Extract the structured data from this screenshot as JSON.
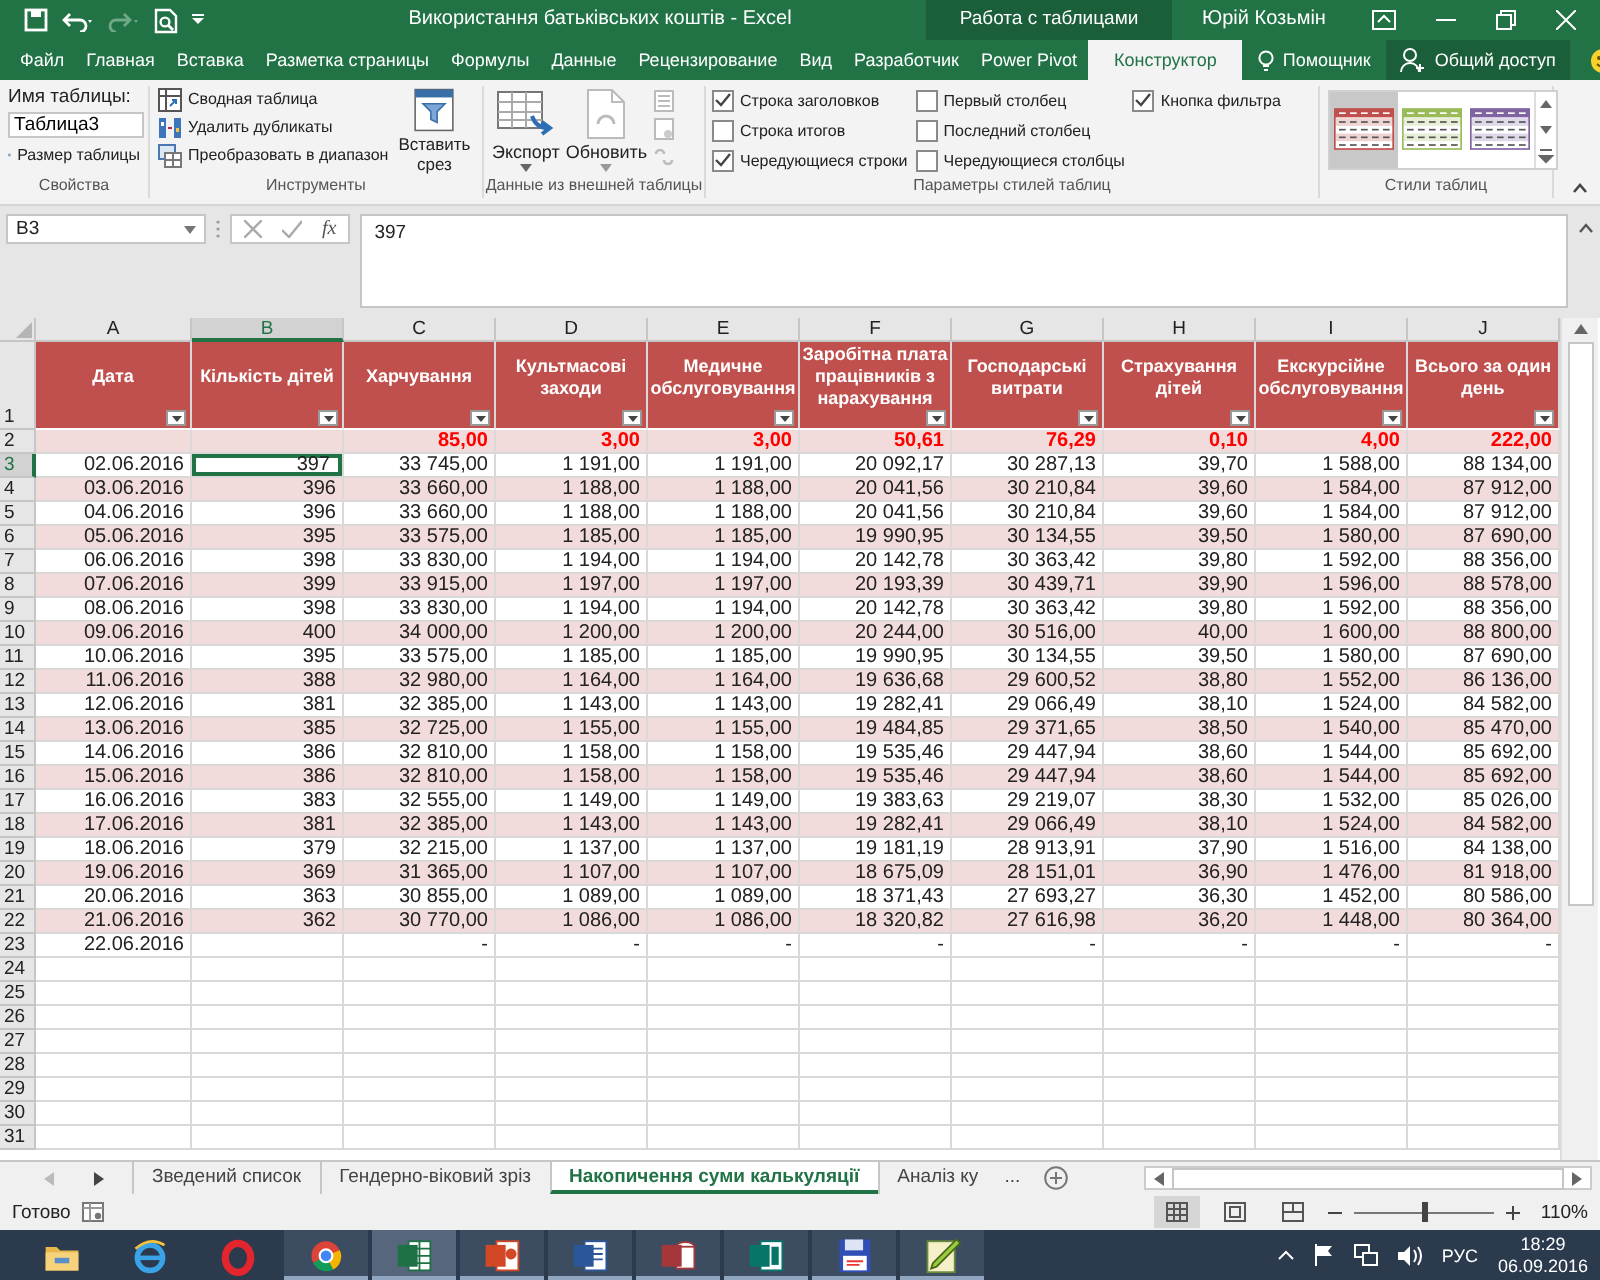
{
  "window": {
    "title": "Використання батьківських коштів  -  Excel",
    "context_title": "Работа с таблицами",
    "user": "Юрій Козьмін"
  },
  "ribbon_tabs": [
    {
      "label": "Файл",
      "selected": false
    },
    {
      "label": "Главная",
      "selected": false
    },
    {
      "label": "Вставка",
      "selected": false
    },
    {
      "label": "Разметка страницы",
      "selected": false
    },
    {
      "label": "Формулы",
      "selected": false
    },
    {
      "label": "Данные",
      "selected": false
    },
    {
      "label": "Рецензирование",
      "selected": false
    },
    {
      "label": "Вид",
      "selected": false
    },
    {
      "label": "Разработчик",
      "selected": false
    },
    {
      "label": "Power Pivot",
      "selected": false
    },
    {
      "label": "Конструктор",
      "selected": true
    }
  ],
  "tell_me": "Помощник",
  "share": "Общий доступ",
  "properties": {
    "name_label": "Имя таблицы:",
    "table_name": "Таблица3",
    "resize": "Размер таблицы",
    "group": "Свойства"
  },
  "tools": {
    "items": [
      "Сводная таблица",
      "Удалить дубликаты",
      "Преобразовать в диапазон"
    ],
    "slicer": "Вставить срез",
    "group": "Инструменты"
  },
  "external_data": {
    "export": "Экспорт",
    "refresh": "Обновить",
    "group": "Данные из внешней таблицы"
  },
  "style_options": {
    "group": "Параметры стилей таблиц",
    "items": [
      {
        "kind": "header_row",
        "label": "Строка заголовков",
        "checked": true
      },
      {
        "kind": "total_row",
        "label": "Строка итогов",
        "checked": false
      },
      {
        "kind": "banded_rows",
        "label": "Чередующиеся строки",
        "checked": true
      },
      {
        "kind": "first_column",
        "label": "Первый столбец",
        "checked": false
      },
      {
        "kind": "last_column",
        "label": "Последний столбец",
        "checked": false
      },
      {
        "kind": "banded_columns",
        "label": "Чередующиеся столбцы",
        "checked": false
      },
      {
        "kind": "filter_button",
        "label": "Кнопка фильтра",
        "checked": true
      }
    ]
  },
  "table_styles": {
    "group": "Стили таблиц",
    "items": [
      {
        "color": "#c0504d",
        "selected": true
      },
      {
        "color": "#9bbb59",
        "selected": false
      },
      {
        "color": "#8064a2",
        "selected": false
      }
    ]
  },
  "formula_bar": {
    "name_box": "B3",
    "function_label": "fx",
    "formula": "397"
  },
  "sheet": {
    "columns": [
      {
        "letter": "A",
        "selected": false
      },
      {
        "letter": "B",
        "selected": true
      },
      {
        "letter": "C",
        "selected": false
      },
      {
        "letter": "D",
        "selected": false
      },
      {
        "letter": "E",
        "selected": false
      },
      {
        "letter": "F",
        "selected": false
      },
      {
        "letter": "G",
        "selected": false
      },
      {
        "letter": "H",
        "selected": false
      },
      {
        "letter": "I",
        "selected": false
      },
      {
        "letter": "J",
        "selected": false
      }
    ],
    "header": {
      "number": "1",
      "cells": [
        "Дата",
        "Кількість дітей",
        "Харчування",
        "Культмасові заходи",
        "Медичне обслуговування",
        "Заробітна плата працівників  з нарахування",
        "Господарські витрати",
        "Страхування дітей",
        "Екскурсійне обслуговування",
        "Всього за один день"
      ]
    },
    "rows": [
      {
        "number": "2",
        "kind": "rates",
        "selected": false,
        "cells": [
          null,
          null,
          "85,00",
          "3,00",
          "3,00",
          "50,61",
          "76,29",
          "0,10",
          "4,00",
          "222,00"
        ]
      },
      {
        "number": "3",
        "kind": "data",
        "selected": true,
        "cells": [
          "02.06.2016",
          "397",
          "33 745,00",
          "1 191,00",
          "1 191,00",
          "20 092,17",
          "30 287,13",
          "39,70",
          "1 588,00",
          "88 134,00"
        ]
      },
      {
        "number": "4",
        "kind": "data",
        "selected": false,
        "cells": [
          "03.06.2016",
          "396",
          "33 660,00",
          "1 188,00",
          "1 188,00",
          "20 041,56",
          "30 210,84",
          "39,60",
          "1 584,00",
          "87 912,00"
        ]
      },
      {
        "number": "5",
        "kind": "data",
        "selected": false,
        "cells": [
          "04.06.2016",
          "396",
          "33 660,00",
          "1 188,00",
          "1 188,00",
          "20 041,56",
          "30 210,84",
          "39,60",
          "1 584,00",
          "87 912,00"
        ]
      },
      {
        "number": "6",
        "kind": "data",
        "selected": false,
        "cells": [
          "05.06.2016",
          "395",
          "33 575,00",
          "1 185,00",
          "1 185,00",
          "19 990,95",
          "30 134,55",
          "39,50",
          "1 580,00",
          "87 690,00"
        ]
      },
      {
        "number": "7",
        "kind": "data",
        "selected": false,
        "cells": [
          "06.06.2016",
          "398",
          "33 830,00",
          "1 194,00",
          "1 194,00",
          "20 142,78",
          "30 363,42",
          "39,80",
          "1 592,00",
          "88 356,00"
        ]
      },
      {
        "number": "8",
        "kind": "data",
        "selected": false,
        "cells": [
          "07.06.2016",
          "399",
          "33 915,00",
          "1 197,00",
          "1 197,00",
          "20 193,39",
          "30 439,71",
          "39,90",
          "1 596,00",
          "88 578,00"
        ]
      },
      {
        "number": "9",
        "kind": "data",
        "selected": false,
        "cells": [
          "08.06.2016",
          "398",
          "33 830,00",
          "1 194,00",
          "1 194,00",
          "20 142,78",
          "30 363,42",
          "39,80",
          "1 592,00",
          "88 356,00"
        ]
      },
      {
        "number": "10",
        "kind": "data",
        "selected": false,
        "cells": [
          "09.06.2016",
          "400",
          "34 000,00",
          "1 200,00",
          "1 200,00",
          "20 244,00",
          "30 516,00",
          "40,00",
          "1 600,00",
          "88 800,00"
        ]
      },
      {
        "number": "11",
        "kind": "data",
        "selected": false,
        "cells": [
          "10.06.2016",
          "395",
          "33 575,00",
          "1 185,00",
          "1 185,00",
          "19 990,95",
          "30 134,55",
          "39,50",
          "1 580,00",
          "87 690,00"
        ]
      },
      {
        "number": "12",
        "kind": "data",
        "selected": false,
        "cells": [
          "11.06.2016",
          "388",
          "32 980,00",
          "1 164,00",
          "1 164,00",
          "19 636,68",
          "29 600,52",
          "38,80",
          "1 552,00",
          "86 136,00"
        ]
      },
      {
        "number": "13",
        "kind": "data",
        "selected": false,
        "cells": [
          "12.06.2016",
          "381",
          "32 385,00",
          "1 143,00",
          "1 143,00",
          "19 282,41",
          "29 066,49",
          "38,10",
          "1 524,00",
          "84 582,00"
        ]
      },
      {
        "number": "14",
        "kind": "data",
        "selected": false,
        "cells": [
          "13.06.2016",
          "385",
          "32 725,00",
          "1 155,00",
          "1 155,00",
          "19 484,85",
          "29 371,65",
          "38,50",
          "1 540,00",
          "85 470,00"
        ]
      },
      {
        "number": "15",
        "kind": "data",
        "selected": false,
        "cells": [
          "14.06.2016",
          "386",
          "32 810,00",
          "1 158,00",
          "1 158,00",
          "19 535,46",
          "29 447,94",
          "38,60",
          "1 544,00",
          "85 692,00"
        ]
      },
      {
        "number": "16",
        "kind": "data",
        "selected": false,
        "cells": [
          "15.06.2016",
          "386",
          "32 810,00",
          "1 158,00",
          "1 158,00",
          "19 535,46",
          "29 447,94",
          "38,60",
          "1 544,00",
          "85 692,00"
        ]
      },
      {
        "number": "17",
        "kind": "data",
        "selected": false,
        "cells": [
          "16.06.2016",
          "383",
          "32 555,00",
          "1 149,00",
          "1 149,00",
          "19 383,63",
          "29 219,07",
          "38,30",
          "1 532,00",
          "85 026,00"
        ]
      },
      {
        "number": "18",
        "kind": "data",
        "selected": false,
        "cells": [
          "17.06.2016",
          "381",
          "32 385,00",
          "1 143,00",
          "1 143,00",
          "19 282,41",
          "29 066,49",
          "38,10",
          "1 524,00",
          "84 582,00"
        ]
      },
      {
        "number": "19",
        "kind": "data",
        "selected": false,
        "cells": [
          "18.06.2016",
          "379",
          "32 215,00",
          "1 137,00",
          "1 137,00",
          "19 181,19",
          "28 913,91",
          "37,90",
          "1 516,00",
          "84 138,00"
        ]
      },
      {
        "number": "20",
        "kind": "data",
        "selected": false,
        "cells": [
          "19.06.2016",
          "369",
          "31 365,00",
          "1 107,00",
          "1 107,00",
          "18 675,09",
          "28 151,01",
          "36,90",
          "1 476,00",
          "81 918,00"
        ]
      },
      {
        "number": "21",
        "kind": "data",
        "selected": false,
        "cells": [
          "20.06.2016",
          "363",
          "30 855,00",
          "1 089,00",
          "1 089,00",
          "18 371,43",
          "27 693,27",
          "36,30",
          "1 452,00",
          "80 586,00"
        ]
      },
      {
        "number": "22",
        "kind": "data",
        "selected": false,
        "cells": [
          "21.06.2016",
          "362",
          "30 770,00",
          "1 086,00",
          "1 086,00",
          "18 320,82",
          "27 616,98",
          "36,20",
          "1 448,00",
          "80 364,00"
        ]
      },
      {
        "number": "23",
        "kind": "data",
        "selected": false,
        "cells": [
          "22.06.2016",
          null,
          "-",
          "-",
          "-",
          "-",
          "-",
          "-",
          "-",
          "-"
        ]
      }
    ],
    "empty_rows": [
      "24",
      "25",
      "26",
      "27",
      "28",
      "29",
      "30",
      "31"
    ]
  },
  "sheet_tabs": [
    {
      "label": "Зведений список",
      "selected": false
    },
    {
      "label": "Гендерно-віковий зріз",
      "selected": false
    },
    {
      "label": "Накопичення суми калькуляції",
      "selected": true
    },
    {
      "label": "Аналіз ку",
      "selected": false
    }
  ],
  "sheet_tabs_more": "...",
  "status_bar": {
    "status": "Готово",
    "zoom": {
      "level": 0.5,
      "reading": "110%"
    }
  },
  "taskbar": {
    "apps": [
      {
        "kind": "explorer",
        "running": false,
        "selected": false
      },
      {
        "kind": "ie",
        "running": false,
        "selected": false
      },
      {
        "kind": "opera",
        "running": false,
        "selected": false
      },
      {
        "kind": "chrome",
        "running": true,
        "selected": false
      },
      {
        "kind": "excel",
        "running": true,
        "selected": true
      },
      {
        "kind": "powerpoint",
        "running": true,
        "selected": false
      },
      {
        "kind": "word",
        "running": true,
        "selected": false
      },
      {
        "kind": "access",
        "running": true,
        "selected": false
      },
      {
        "kind": "publisher",
        "running": true,
        "selected": false
      },
      {
        "kind": "floppy",
        "running": true,
        "selected": false
      },
      {
        "kind": "editor",
        "running": true,
        "selected": false
      }
    ],
    "language": "РУС",
    "time": "18:29",
    "date": "06.09.2016"
  }
}
